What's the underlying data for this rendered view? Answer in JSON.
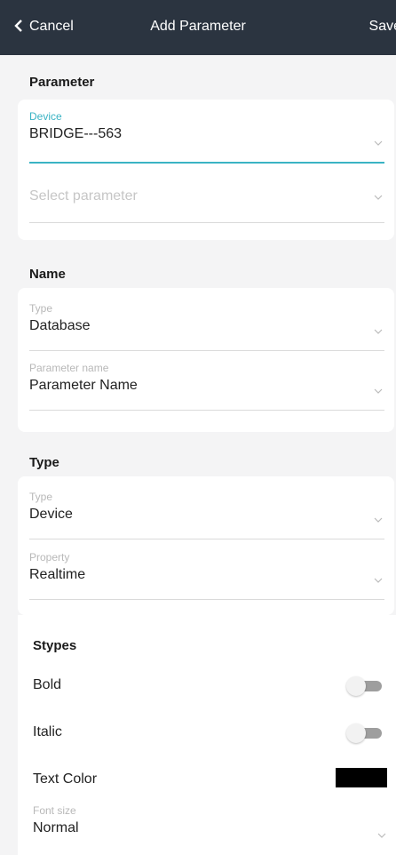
{
  "header": {
    "cancel_label": "Cancel",
    "title": "Add Parameter",
    "save_label": "Save"
  },
  "parameter_section": {
    "title": "Parameter",
    "device_label": "Device",
    "device_value": "BRIDGE---563",
    "parameter_placeholder": "Select parameter"
  },
  "name_section": {
    "title": "Name",
    "type_label": "Type",
    "type_value": "Database",
    "param_name_label": "Parameter name",
    "param_name_value": "Parameter Name"
  },
  "type_section": {
    "title": "Type",
    "type_label": "Type",
    "type_value": "Device",
    "property_label": "Property",
    "property_value": "Realtime"
  },
  "styles_section": {
    "title": "Stypes",
    "bold_label": "Bold",
    "bold_on": false,
    "italic_label": "Italic",
    "italic_on": false,
    "text_color_label": "Text Color",
    "text_color": "#000000",
    "font_size_label": "Font size",
    "font_size_value": "Normal"
  },
  "colors": {
    "header_bg": "#2b3440",
    "accent": "#3ab3c4"
  }
}
